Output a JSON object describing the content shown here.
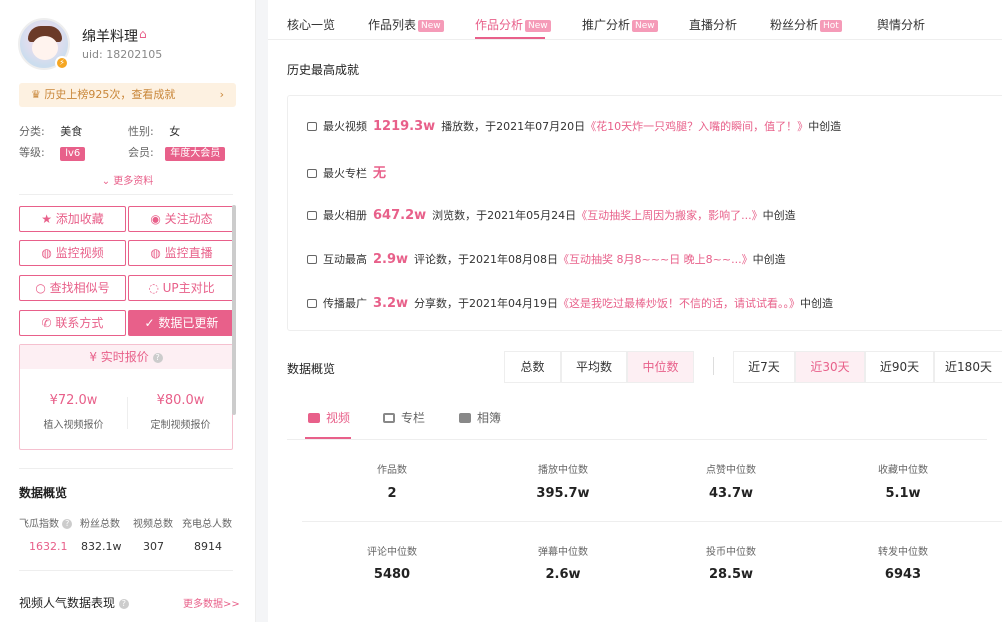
{
  "profile": {
    "name": "绵羊料理",
    "uid": "uid: 18202105",
    "rank_text": "历史上榜925次，查看成就",
    "category_label": "分类:",
    "category": "美食",
    "gender_label": "性别:",
    "gender": "女",
    "level_label": "等级:",
    "level": "lv6",
    "member_label": "会员:",
    "member": "年度大会员",
    "more": "更多资料"
  },
  "actions": {
    "fav": "添加收藏",
    "follow": "关注动态",
    "monitor_video": "监控视频",
    "monitor_live": "监控直播",
    "similar": "查找相似号",
    "compare": "UP主对比",
    "contact": "联系方式",
    "updated": "数据已更新"
  },
  "price": {
    "title": "实时报价",
    "implant_value": "¥72.0w",
    "implant_label": "植入视频报价",
    "custom_value": "¥80.0w",
    "custom_label": "定制视频报价"
  },
  "overview": {
    "title": "数据概览",
    "headers": [
      "飞瓜指数",
      "粉丝总数",
      "视频总数",
      "充电总人数"
    ],
    "values": [
      "1632.1",
      "832.1w",
      "307",
      "8914"
    ]
  },
  "video_perf": {
    "title": "视频人气数据表现",
    "more": "更多数据>>"
  },
  "tabs": [
    {
      "label": "核心一览",
      "badge": ""
    },
    {
      "label": "作品列表",
      "badge": "New"
    },
    {
      "label": "作品分析",
      "badge": "New"
    },
    {
      "label": "推广分析",
      "badge": "New"
    },
    {
      "label": "直播分析",
      "badge": ""
    },
    {
      "label": "粉丝分析",
      "badge": "Hot"
    },
    {
      "label": "舆情分析",
      "badge": ""
    }
  ],
  "history": {
    "title": "历史最高成就",
    "rows": [
      {
        "label": "最火视频",
        "value": "1219.3w",
        "text": "播放数，于2021年07月20日",
        "link": "《花10天炸一只鸡腿？入嘴的瞬间，值了！》",
        "suffix": "中创造"
      },
      {
        "label": "最火专栏",
        "value": "无",
        "text": "",
        "link": "",
        "suffix": ""
      },
      {
        "label": "最火相册",
        "value": "647.2w",
        "text": "浏览数，于2021年05月24日",
        "link": "《互动抽奖上周因为搬家，影响了...》",
        "suffix": "中创造"
      },
      {
        "label": "互动最高",
        "value": "2.9w",
        "text": "评论数，于2021年08月08日",
        "link": "《互动抽奖 8月8~~~日 晚上8~~...》",
        "suffix": "中创造"
      },
      {
        "label": "传播最广",
        "value": "3.2w",
        "text": "分享数，于2021年04月19日",
        "link": "《这是我吃过最棒炒饭！不信的话，请试试看。。》",
        "suffix": "中创造"
      }
    ]
  },
  "data_overview": {
    "title": "数据概览",
    "modes": [
      "总数",
      "平均数",
      "中位数"
    ],
    "ranges": [
      "近7天",
      "近30天",
      "近90天",
      "近180天"
    ],
    "content_tabs": [
      "视频",
      "专栏",
      "相簿"
    ],
    "metrics": [
      {
        "label": "作品数",
        "value": "2"
      },
      {
        "label": "播放中位数",
        "value": "395.7w"
      },
      {
        "label": "点赞中位数",
        "value": "43.7w"
      },
      {
        "label": "收藏中位数",
        "value": "5.1w"
      },
      {
        "label": "评论中位数",
        "value": "5480"
      },
      {
        "label": "弹幕中位数",
        "value": "2.6w"
      },
      {
        "label": "投币中位数",
        "value": "28.5w"
      },
      {
        "label": "转发中位数",
        "value": "6943"
      }
    ]
  },
  "colors": {
    "accent": "#e8608a",
    "gold": "#c9873a"
  }
}
